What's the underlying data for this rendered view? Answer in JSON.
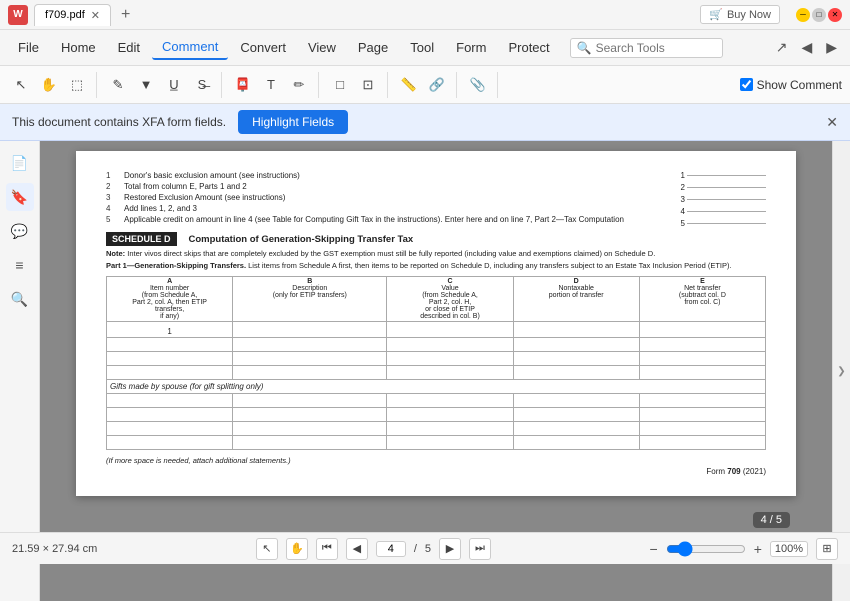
{
  "app": {
    "icon": "W",
    "tab_title": "f709.pdf",
    "buy_now": "Buy Now"
  },
  "menubar": {
    "file": "File",
    "home": "Home",
    "edit": "Edit",
    "comment": "Comment",
    "convert": "Convert",
    "view": "View",
    "page": "Page",
    "tool": "Tool",
    "form": "Form",
    "protect": "Protect",
    "search_placeholder": "Search Tools"
  },
  "toolbar": {
    "show_comment": "Show Comment",
    "show_comment_checked": true
  },
  "xfa_bar": {
    "message": "This document contains XFA form fields.",
    "highlight_btn": "Highlight Fields",
    "close_aria": "Close"
  },
  "document": {
    "lines": [
      {
        "num": "1",
        "text": "Donor's basic exclusion amount (see instructions)"
      },
      {
        "num": "2",
        "text": "Total from column E, Parts 1 and 2"
      },
      {
        "num": "3",
        "text": "Restored Exclusion Amount (see instructions)"
      },
      {
        "num": "4",
        "text": "Add lines 1, 2, and 3"
      },
      {
        "num": "5",
        "text": "Applicable credit on amount in line 4 (see Table for Computing Gift Tax in the instructions). Enter here and on line 7, Part 2—Tax Computation"
      }
    ],
    "schedule_label": "SCHEDULE D",
    "schedule_title": "Computation of Generation-Skipping Transfer Tax",
    "note": "Note: Inter vivos direct skips that are completely excluded by the GST exemption must still be fully reported (including value and exemptions claimed) on Schedule D.",
    "part1_header": "Part 1—Generation-Skipping Transfers.",
    "part1_desc": "List items from Schedule A first, then items to be reported on Schedule D, including any transfers subject to an Estate Tax Inclusion Period (ETIP).",
    "col_a_label": "A",
    "col_a_sub": "Item number\n(from Schedule A,\nPart 2, col. A, then ETIP\ntransfers,\nif any)",
    "col_b_label": "B",
    "col_b_sub": "Description\n(only for ETIP transfers)",
    "col_c_label": "C",
    "col_c_sub": "Value\n(from Schedule A,\nPart 2, col. H,\nor close of ETIP\ndescribed in col. B)",
    "col_d_label": "D",
    "col_d_sub": "Nontaxable\nportion of transfer",
    "col_e_label": "E",
    "col_e_sub": "Net transfer\n(subtract col. D\nfrom col. C)",
    "first_row_a": "1",
    "gifts_spouse": "Gifts made by spouse (for gift splitting only)",
    "if_more": "(If more space is needed, attach additional statements.)",
    "form_num": "Form 709 (2021)"
  },
  "bottombar": {
    "dimensions": "21.59 × 27.94 cm",
    "page_current": "4",
    "page_total": "5",
    "page_nav_display": "4 / 5",
    "zoom_percent": "100%",
    "page_indicator": "4 / 5"
  },
  "icons": {
    "save": "💾",
    "print": "🖨",
    "open": "📂",
    "cursor": "↖",
    "hand": "✋",
    "search": "🔍",
    "first_page": "⏮",
    "prev_page": "◀",
    "next_page": "▶",
    "last_page": "⏭",
    "zoom_out": "−",
    "zoom_in": "+",
    "nav_arrow_left": "❮",
    "nav_arrow_right": "❯"
  },
  "colors": {
    "accent": "#1a73e8",
    "xfa_bg": "#e8f0fe",
    "tab_active": "#1a73e8"
  }
}
